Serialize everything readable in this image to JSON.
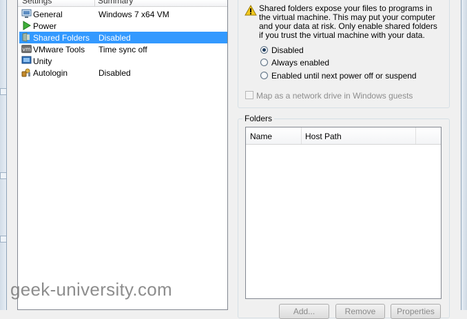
{
  "list": {
    "header": {
      "settings": "Settings",
      "summary": "Summary"
    },
    "items": [
      {
        "icon": "monitor-icon",
        "name": "General",
        "summary": "Windows 7 x64 VM",
        "selected": false
      },
      {
        "icon": "power-icon",
        "name": "Power",
        "summary": "",
        "selected": false
      },
      {
        "icon": "shared-folders-icon",
        "name": "Shared Folders",
        "summary": "Disabled",
        "selected": true
      },
      {
        "icon": "vmware-tools-icon",
        "name": "VMware Tools",
        "summary": "Time sync off",
        "selected": false
      },
      {
        "icon": "unity-icon",
        "name": "Unity",
        "summary": "",
        "selected": false
      },
      {
        "icon": "autologin-icon",
        "name": "Autologin",
        "summary": "Disabled",
        "selected": false
      }
    ]
  },
  "sharing": {
    "warning": "Shared folders expose your files to programs in the virtual machine. This may put your computer and your data at risk. Only enable shared folders if you trust the virtual machine with your data.",
    "options": [
      {
        "label": "Disabled",
        "checked": true
      },
      {
        "label": "Always enabled",
        "checked": false
      },
      {
        "label": "Enabled until next power off or suspend",
        "checked": false
      }
    ],
    "map_drive": {
      "label": "Map as a network drive in Windows guests",
      "checked": false,
      "enabled": false
    }
  },
  "folders": {
    "legend": "Folders",
    "columns": {
      "name": "Name",
      "host_path": "Host Path"
    },
    "buttons": {
      "add": "Add...",
      "remove": "Remove",
      "properties": "Properties"
    }
  },
  "watermark": "geek-university.com",
  "colors": {
    "selection": "#3399ff",
    "warning": "#f2c81d"
  }
}
